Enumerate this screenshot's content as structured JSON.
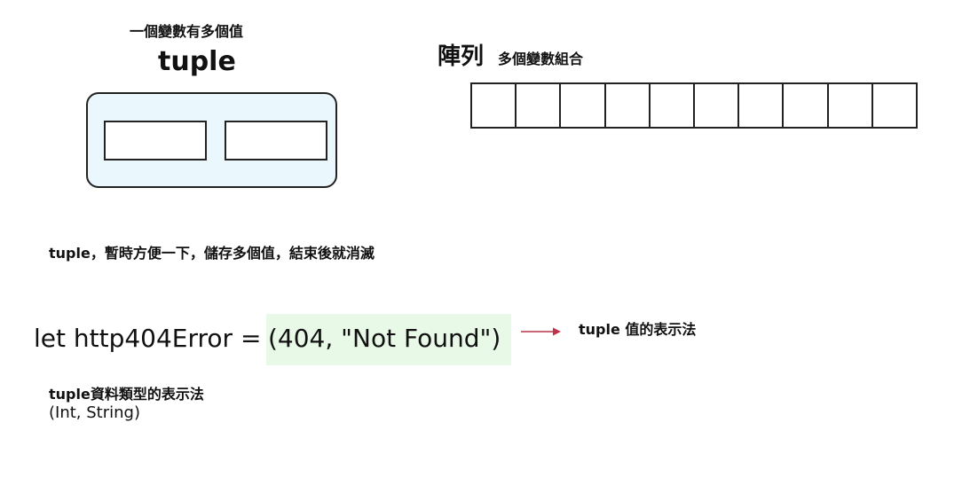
{
  "tuple_section": {
    "caption": "一個變數有多個值",
    "title": "tuple",
    "slot_count": 2
  },
  "array_section": {
    "title": "陣列",
    "subtitle": "多個變數組合",
    "cell_count": 10
  },
  "description": "tuple，暫時方便一下，儲存多個值，結束後就消滅",
  "code": {
    "prefix": "let http404Error = ",
    "value": "(404, \"Not Found\")",
    "highlight_color": "#e8f9e8"
  },
  "annotation": {
    "label": "tuple 值的表示法",
    "arrow_color": "#c0304a"
  },
  "type_notation": {
    "label": "tuple資料類型的表示法",
    "value": "(Int, String)"
  },
  "colors": {
    "tuple_box_fill": "#eaf7fd",
    "border": "#222222"
  }
}
